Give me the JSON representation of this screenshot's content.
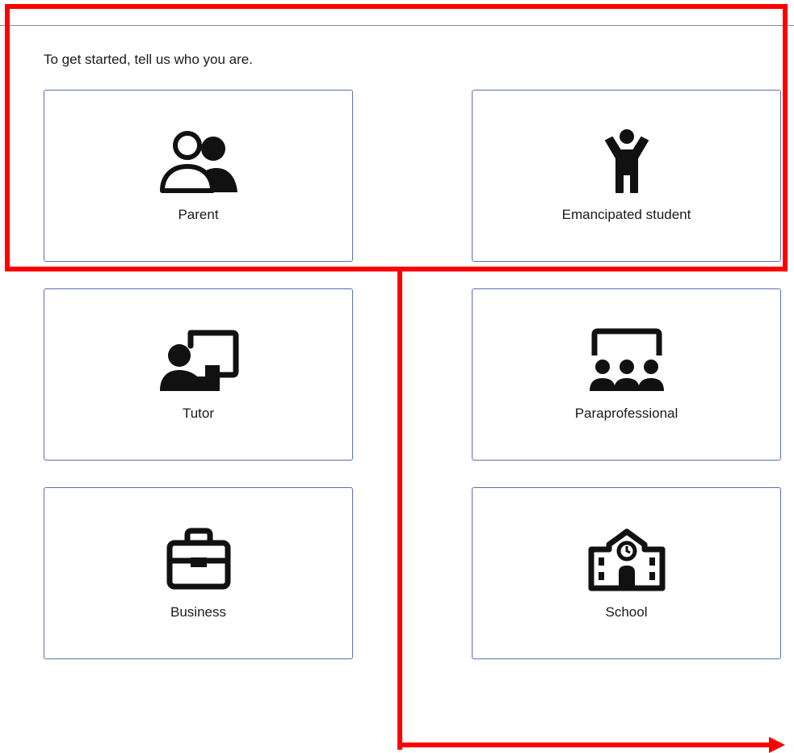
{
  "intro_text": "To get started, tell us who you are.",
  "roles": [
    {
      "label": "Parent",
      "icon": "parent-icon"
    },
    {
      "label": "Emancipated student",
      "icon": "student-icon"
    },
    {
      "label": "Tutor",
      "icon": "tutor-icon"
    },
    {
      "label": "Paraprofessional",
      "icon": "paraprofessional-icon"
    },
    {
      "label": "Business",
      "icon": "briefcase-icon"
    },
    {
      "label": "School",
      "icon": "school-icon"
    }
  ],
  "colors": {
    "card_border": "#5a6fb8",
    "annotation": "#ff0000",
    "icon": "#111111"
  }
}
